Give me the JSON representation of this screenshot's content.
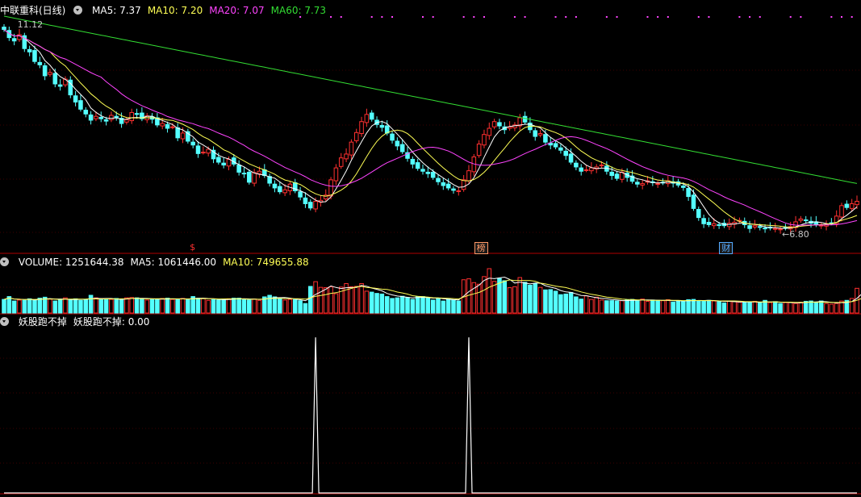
{
  "title": "中联重科(日线)",
  "indicators": {
    "main": [
      {
        "label": "MA5: 7.37",
        "color": "#ffffff"
      },
      {
        "label": "MA10: 7.20",
        "color": "#ffff55"
      },
      {
        "label": "MA20: 7.07",
        "color": "#ff44ff"
      },
      {
        "label": "MA60: 7.73",
        "color": "#33dd33"
      }
    ],
    "volume": [
      {
        "label": "VOLUME: 1251644.38",
        "color": "#ffffff"
      },
      {
        "label": "MA5: 1061446.00",
        "color": "#ffffff"
      },
      {
        "label": "MA10: 749655.88",
        "color": "#ffff55"
      }
    ],
    "signal": [
      {
        "label": "妖股跑不掉",
        "color": "#ffffff"
      },
      {
        "label": "妖股跑不掉: 0.00",
        "color": "#ffffff"
      }
    ]
  },
  "annotations": {
    "high": "11.12",
    "low": "6.80"
  },
  "event_badges": [
    {
      "label": "$",
      "color": "#ff3030",
      "bar": 37
    },
    {
      "label": "榜",
      "color": "#ff9966",
      "bar": 93
    },
    {
      "label": "财",
      "color": "#55aaff",
      "bar": 141
    }
  ],
  "colors": {
    "up": "#ff3030",
    "down": "#54ffff",
    "grid": "#7a0000",
    "ma5": "#ffffff",
    "ma10": "#ffff55",
    "ma20": "#ff44ff",
    "ma60": "#33dd33",
    "dots": "#ff44ff"
  },
  "chart_data": {
    "type": "candlestick",
    "price_range": [
      6.6,
      11.3
    ],
    "closes": [
      11.02,
      10.85,
      10.78,
      10.91,
      10.62,
      10.55,
      10.35,
      10.28,
      10.05,
      10.12,
      9.88,
      9.83,
      9.98,
      9.65,
      9.5,
      9.35,
      9.25,
      9.12,
      9.2,
      9.15,
      9.1,
      9.22,
      9.18,
      9.05,
      9.13,
      9.28,
      9.24,
      9.15,
      9.21,
      9.14,
      9.02,
      9.05,
      8.95,
      8.98,
      8.75,
      8.85,
      8.68,
      8.6,
      8.42,
      8.45,
      8.51,
      8.31,
      8.24,
      8.18,
      8.3,
      8.2,
      8.03,
      8.0,
      7.82,
      8.02,
      8.05,
      7.96,
      7.8,
      7.7,
      7.62,
      7.66,
      7.78,
      7.64,
      7.51,
      7.37,
      7.28,
      7.42,
      7.44,
      7.55,
      7.87,
      8.12,
      8.33,
      8.41,
      8.66,
      8.86,
      9.09,
      9.24,
      9.14,
      9.03,
      8.97,
      8.85,
      8.7,
      8.58,
      8.46,
      8.32,
      8.2,
      8.11,
      8.05,
      8.0,
      7.92,
      7.83,
      7.75,
      7.7,
      7.65,
      7.64,
      7.87,
      8.06,
      8.35,
      8.62,
      8.82,
      8.95,
      9.09,
      9.0,
      8.92,
      8.98,
      9.02,
      9.17,
      9.08,
      8.92,
      8.78,
      8.84,
      8.66,
      8.6,
      8.56,
      8.49,
      8.38,
      8.24,
      8.14,
      8.05,
      8.08,
      8.12,
      8.14,
      8.18,
      8.05,
      7.96,
      7.9,
      8.03,
      7.92,
      7.84,
      7.78,
      7.79,
      7.85,
      7.81,
      7.79,
      7.81,
      7.85,
      7.8,
      7.76,
      7.71,
      7.52,
      7.27,
      7.08,
      6.95,
      6.93,
      6.95,
      6.93,
      6.91,
      6.96,
      6.98,
      7.02,
      6.93,
      6.85,
      6.91,
      6.88,
      6.85,
      6.86,
      6.85,
      6.84,
      6.86,
      6.89,
      6.99,
      7.05,
      7.02,
      6.96,
      6.93,
      6.92,
      6.94,
      6.97,
      7.11,
      7.33,
      7.29,
      7.37,
      7.42
    ],
    "ma_series": [
      "MA5",
      "MA10",
      "MA20",
      "MA60"
    ],
    "volume_range": [
      0,
      1400000
    ],
    "volumes": [
      430000,
      520000,
      380000,
      410000,
      400000,
      450000,
      420000,
      470000,
      500000,
      440000,
      380000,
      420000,
      480000,
      410000,
      450000,
      400000,
      430000,
      560000,
      480000,
      420000,
      420000,
      430000,
      460000,
      430000,
      480000,
      490000,
      480000,
      450000,
      410000,
      430000,
      440000,
      460000,
      470000,
      430000,
      430000,
      460000,
      440000,
      520000,
      470000,
      460000,
      400000,
      420000,
      410000,
      440000,
      450000,
      470000,
      470000,
      430000,
      410000,
      440000,
      400000,
      510000,
      560000,
      510000,
      450000,
      410000,
      430000,
      420000,
      390000,
      300000,
      840000,
      990000,
      810000,
      800000,
      830000,
      610000,
      820000,
      930000,
      830000,
      840000,
      930000,
      690000,
      660000,
      620000,
      600000,
      520000,
      460000,
      480000,
      530000,
      490000,
      430000,
      510000,
      520000,
      490000,
      410000,
      460000,
      380000,
      440000,
      420000,
      380000,
      1050000,
      1080000,
      960000,
      910000,
      1150000,
      1400000,
      1000000,
      1090000,
      1020000,
      800000,
      830000,
      1120000,
      970000,
      880000,
      930000,
      810000,
      730000,
      740000,
      690000,
      580000,
      600000,
      650000,
      510000,
      440000,
      540000,
      430000,
      500000,
      410000,
      390000,
      390000,
      380000,
      390000,
      420000,
      430000,
      400000,
      440000,
      370000,
      410000,
      400000,
      390000,
      420000,
      350000,
      390000,
      360000,
      420000,
      430000,
      380000,
      380000,
      400000,
      380000,
      360000,
      320000,
      380000,
      360000,
      340000,
      350000,
      330000,
      370000,
      320000,
      400000,
      330000,
      360000,
      300000,
      330000,
      340000,
      300000,
      340000,
      370000,
      380000,
      350000,
      380000,
      300000,
      280000,
      300000,
      380000,
      400000,
      460000,
      780000,
      1040000,
      1251644
    ],
    "signal_range": [
      0,
      1.0
    ],
    "signal_spikes": [
      {
        "bar": 61,
        "value": 0.95
      },
      {
        "bar": 91,
        "value": 0.95
      }
    ],
    "signal_value": 0.0
  }
}
